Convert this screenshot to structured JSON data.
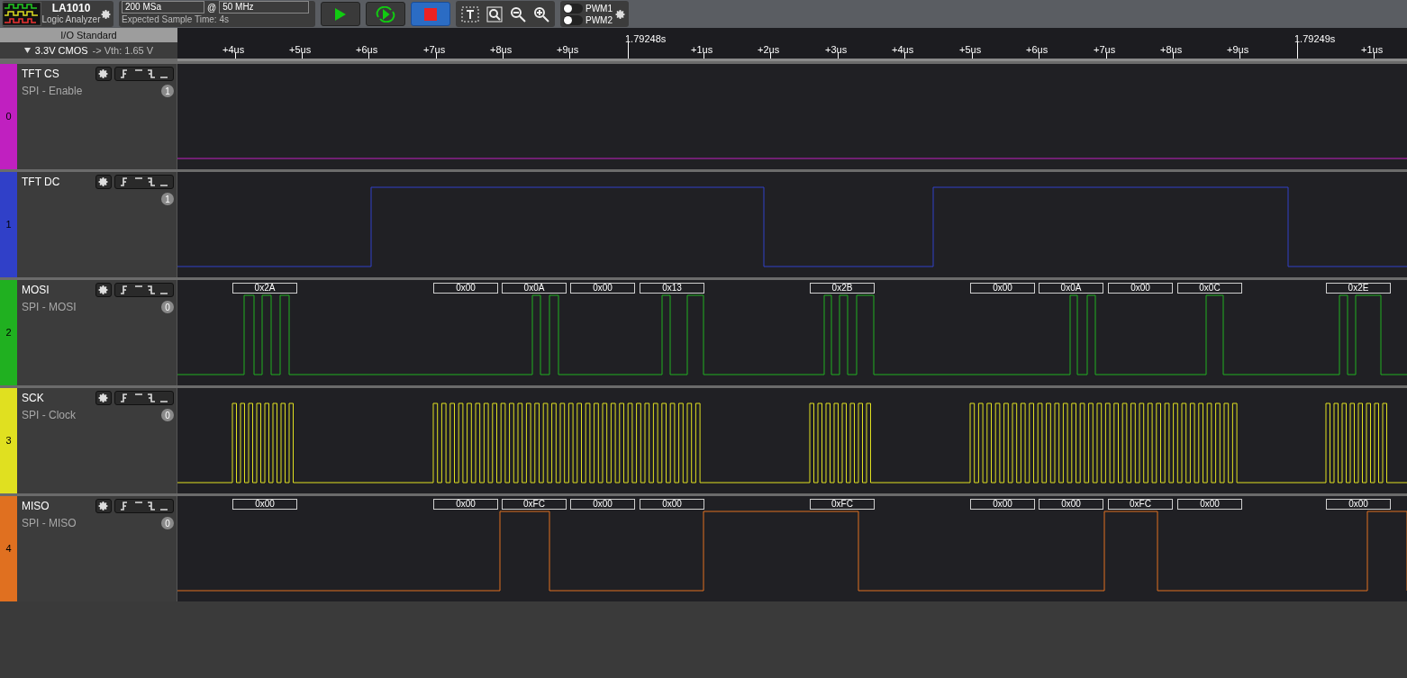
{
  "toolbar": {
    "device": "LA1010",
    "subtitle": "Logic Analyzer",
    "sample_rate": "200 MSa",
    "at": "@",
    "frequency": "50 MHz",
    "sample_time": "Expected Sample Time: 4s",
    "toggles": [
      {
        "label": "PWM1",
        "on": false
      },
      {
        "label": "PWM2",
        "on": false
      }
    ]
  },
  "io_panel": {
    "title": "I/O Standard",
    "standard": "3.3V CMOS",
    "threshold": "-> Vth: 1.65 V"
  },
  "ruler": {
    "ticks": [
      {
        "label": "+4us",
        "kind": "minor"
      },
      {
        "label": "+5us",
        "kind": "minor"
      },
      {
        "label": "+6us",
        "kind": "minor"
      },
      {
        "label": "+7us",
        "kind": "minor"
      },
      {
        "label": "+8us",
        "kind": "minor"
      },
      {
        "label": "+9us",
        "kind": "minor"
      },
      {
        "label": "1.79248s",
        "kind": "major"
      },
      {
        "label": "+1us",
        "kind": "minor"
      },
      {
        "label": "+2us",
        "kind": "minor"
      },
      {
        "label": "+3us",
        "kind": "minor"
      },
      {
        "label": "+4us",
        "kind": "minor"
      },
      {
        "label": "+5us",
        "kind": "minor"
      },
      {
        "label": "+6us",
        "kind": "minor"
      },
      {
        "label": "+7us",
        "kind": "minor"
      },
      {
        "label": "+8us",
        "kind": "minor"
      },
      {
        "label": "+9us",
        "kind": "minor"
      },
      {
        "label": "1.79249s",
        "kind": "major"
      },
      {
        "label": "+1us",
        "kind": "minor"
      }
    ]
  },
  "channels": [
    {
      "number": "0",
      "name": "TFT CS",
      "protocol": "SPI - Enable",
      "count": "1",
      "color": "#c020c0"
    },
    {
      "number": "1",
      "name": "TFT DC",
      "count": "1",
      "color": "#3040c8"
    },
    {
      "number": "2",
      "name": "MOSI",
      "protocol": "SPI - MOSI",
      "count": "0",
      "color": "#20b020",
      "frames": [
        "0x2A",
        "0x00",
        "0x0A",
        "0x00",
        "0x13",
        "0x2B",
        "0x00",
        "0x0A",
        "0x00",
        "0x0C",
        "0x2E"
      ]
    },
    {
      "number": "3",
      "name": "SCK",
      "protocol": "SPI - Clock",
      "count": "0",
      "color": "#e0e020"
    },
    {
      "number": "4",
      "name": "MISO",
      "protocol": "SPI - MISO",
      "count": "0",
      "color": "#e07020",
      "frames": [
        "0x00",
        "0x00",
        "0xFC",
        "0x00",
        "0x00",
        "0xFC",
        "0x00",
        "0x00",
        "0xFC",
        "0x00",
        "0x00"
      ]
    }
  ]
}
